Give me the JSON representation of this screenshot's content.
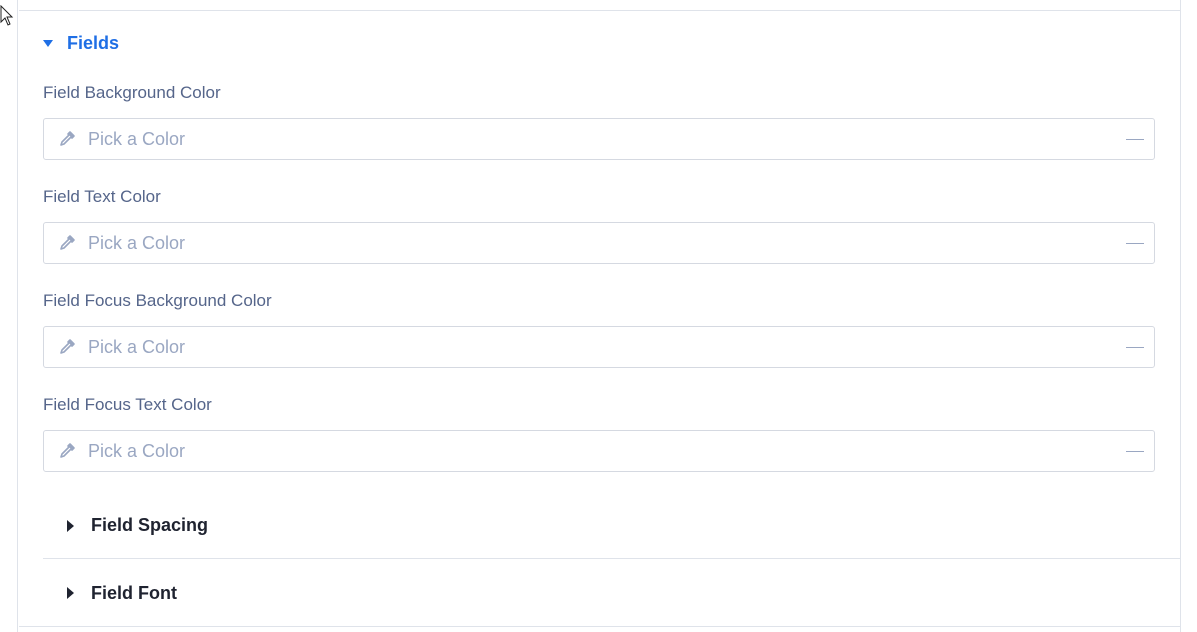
{
  "section": {
    "title": "Fields"
  },
  "fields": [
    {
      "label": "Field Background Color",
      "placeholder": "Pick a Color"
    },
    {
      "label": "Field Text Color",
      "placeholder": "Pick a Color"
    },
    {
      "label": "Field Focus Background Color",
      "placeholder": "Pick a Color"
    },
    {
      "label": "Field Focus Text Color",
      "placeholder": "Pick a Color"
    }
  ],
  "subsections": [
    {
      "title": "Field Spacing"
    },
    {
      "title": "Field Font"
    }
  ],
  "colors": {
    "accent": "#1f6fe5",
    "label": "#55658a",
    "placeholder": "#9aa7c2",
    "border": "#d5d9e1"
  }
}
